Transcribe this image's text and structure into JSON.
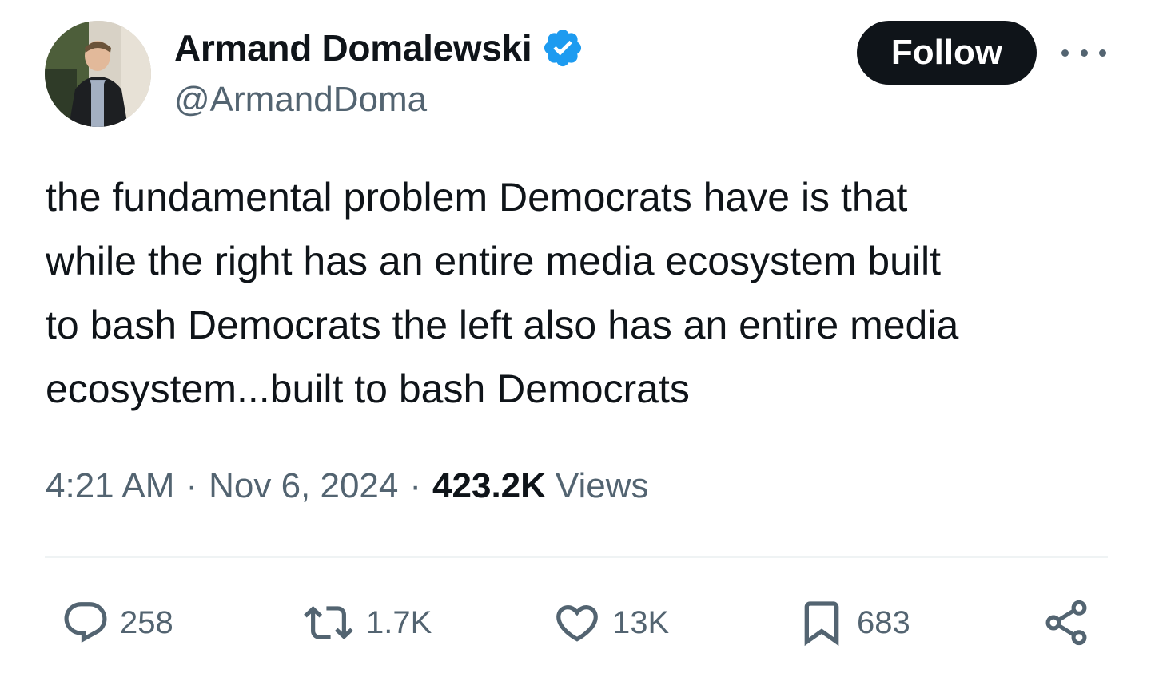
{
  "author": {
    "display_name": "Armand Domalewski",
    "handle": "@ArmandDoma",
    "verified": true,
    "avatar_icon": "avatar-photo"
  },
  "follow_button": {
    "label": "Follow"
  },
  "more_icon": "more-horizontal-icon",
  "tweet": {
    "text": "the fundamental problem Democrats have is that\nwhile the right has an entire media ecosystem built\nto bash Democrats the left also has an entire media\necosystem...built to bash Democrats"
  },
  "meta": {
    "time": "4:21 AM",
    "separator": "·",
    "date": "Nov 6, 2024",
    "views_count": "423.2K",
    "views_label": "Views"
  },
  "actions": {
    "replies": "258",
    "reposts": "1.7K",
    "likes": "13K",
    "bookmarks": "683"
  },
  "colors": {
    "text_primary": "#0f1419",
    "text_secondary": "#536471",
    "verified_blue": "#1d9bf0",
    "follow_bg": "#0f1419",
    "divider": "#eff3f4"
  }
}
